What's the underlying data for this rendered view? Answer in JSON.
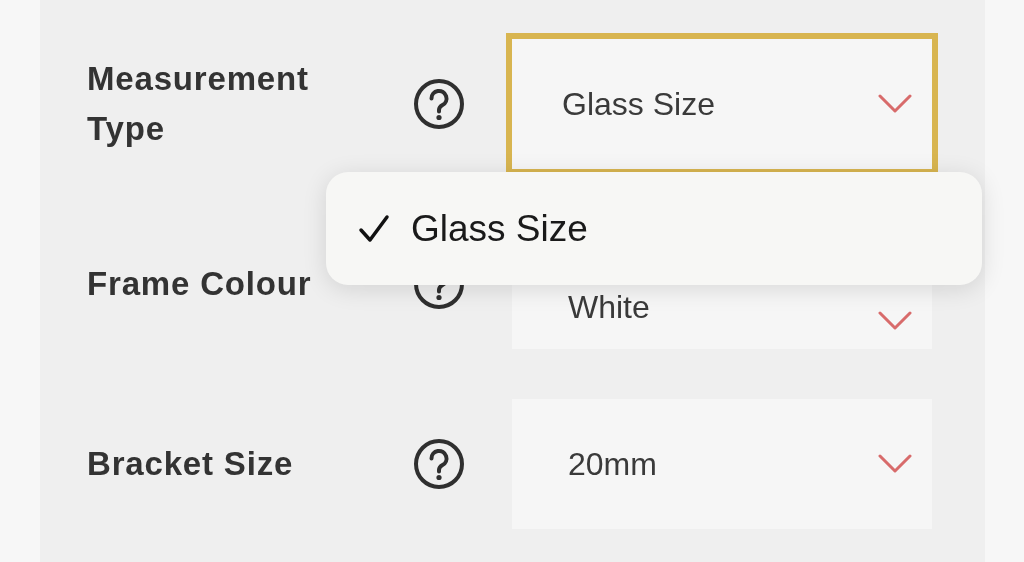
{
  "fields": [
    {
      "label": "Measurement Type",
      "value": "Glass Size",
      "focused": true
    },
    {
      "label": "Frame Colour",
      "value": "White",
      "focused": false
    },
    {
      "label": "Bracket Size",
      "value": "20mm",
      "focused": false
    }
  ],
  "dropdown": {
    "options": [
      {
        "label": "Glass Size",
        "selected": true
      }
    ]
  }
}
